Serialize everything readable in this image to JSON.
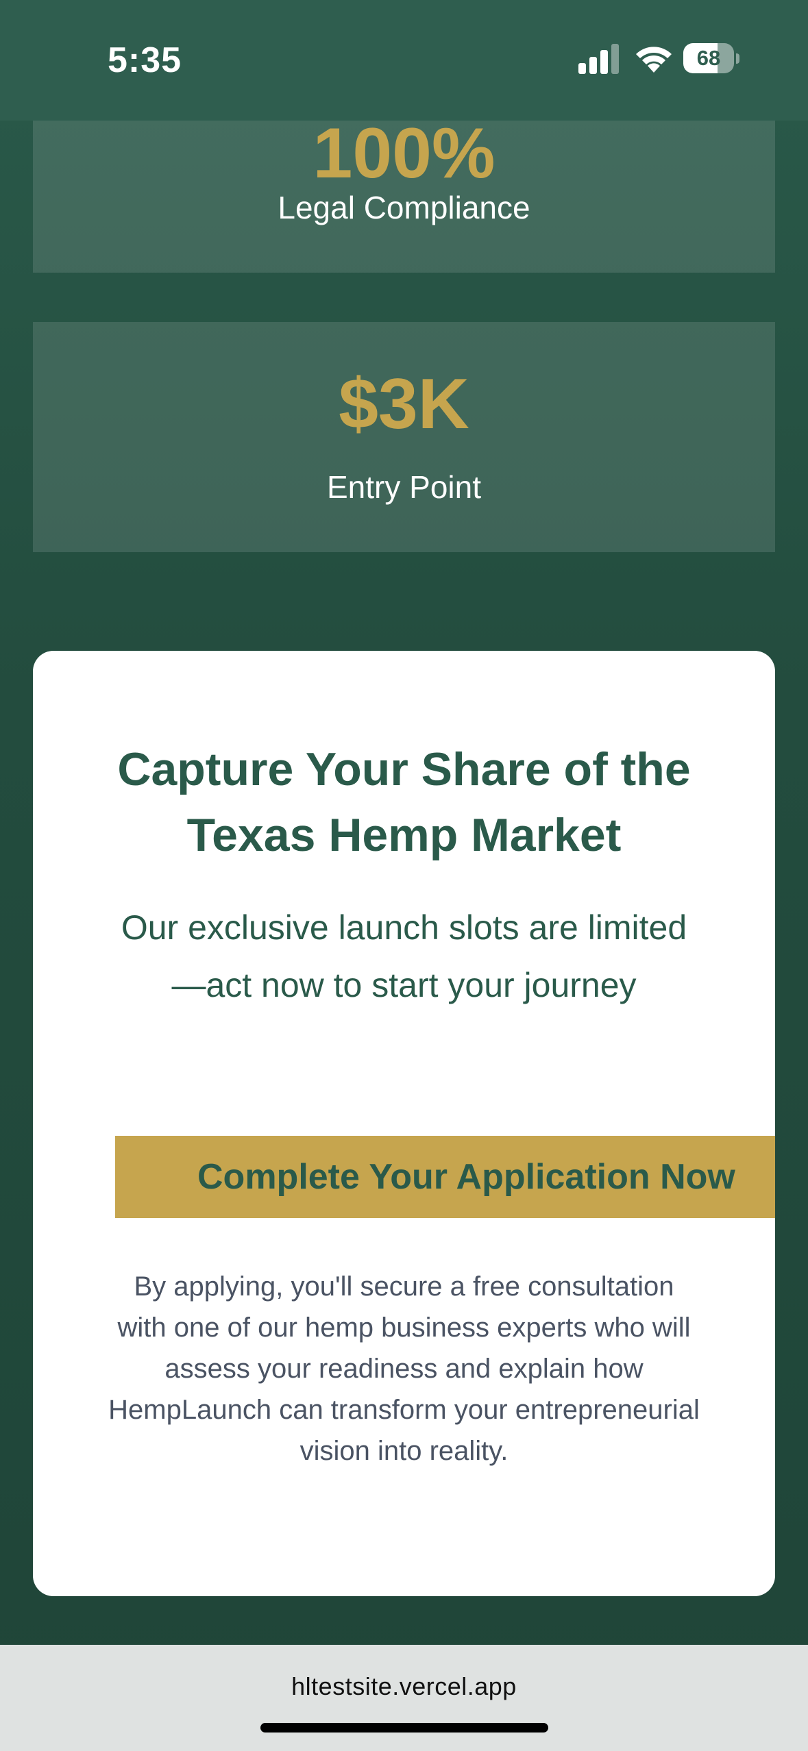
{
  "status_bar": {
    "time": "5:35",
    "battery_level": "68",
    "battery_fraction": 0.68,
    "signal_icon": "cellular-signal-icon",
    "wifi_icon": "wifi-icon"
  },
  "stats": [
    {
      "value": "100%",
      "label": "Legal Compliance"
    },
    {
      "value": "$3K",
      "label": "Entry Point"
    }
  ],
  "cta": {
    "heading": "Capture Your Share of the Texas Hemp Market",
    "subtitle": "Our exclusive launch slots are limited—act now to start your journey",
    "button_label": "Complete Your Application Now",
    "note": "By applying, you'll secure a free consultation with one of our hemp business experts who will assess your readiness and explain how HempLaunch can transform your entrepreneurial vision into reality."
  },
  "browser": {
    "url": "hltestsite.vercel.app"
  },
  "colors": {
    "background_green": "#234c3e",
    "accent_gold": "#c6a54e",
    "heading_green": "#2a5a4a",
    "body_gray": "#4a5363"
  }
}
